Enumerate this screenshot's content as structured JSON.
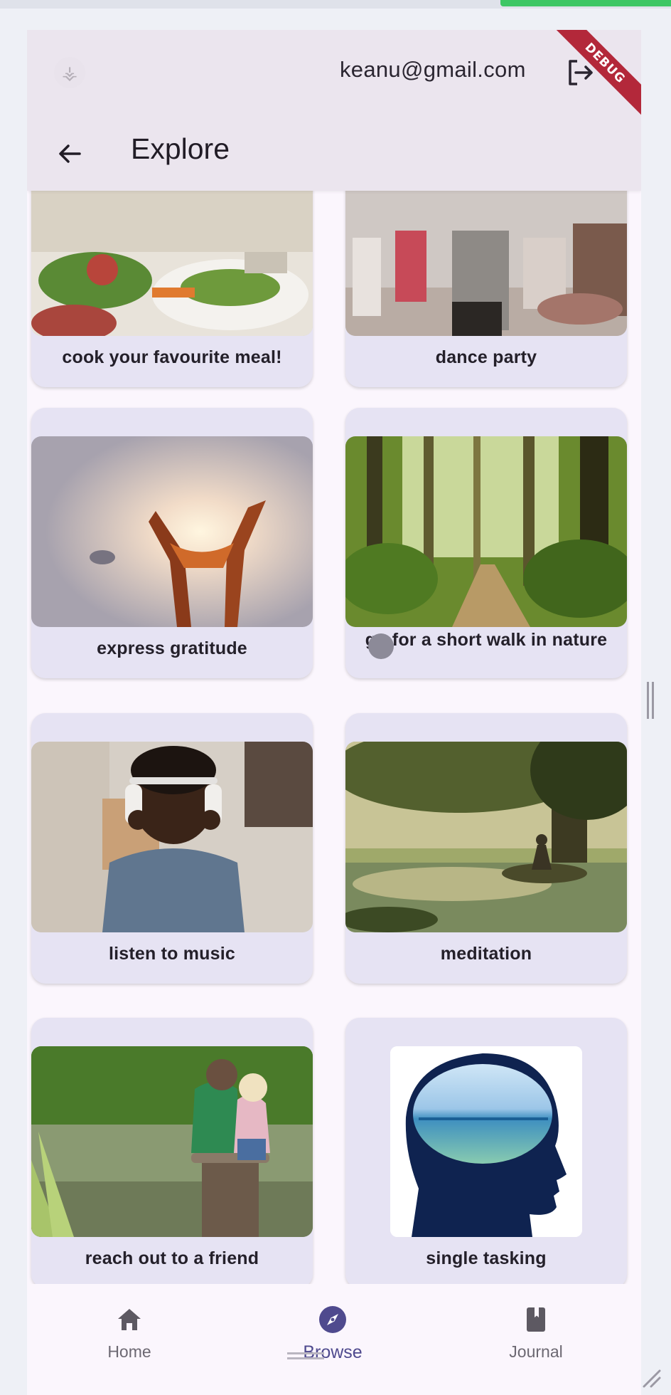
{
  "header": {
    "user_email": "keanu@gmail.com",
    "debug_label": "DEBUG",
    "title": "Explore"
  },
  "cards": [
    {
      "label": "cook your favourite meal!"
    },
    {
      "label": "dance party"
    },
    {
      "label": "express gratitude"
    },
    {
      "label": "go for a short walk in nature"
    },
    {
      "label": "listen to music"
    },
    {
      "label": "meditation"
    },
    {
      "label": "reach out to a friend"
    },
    {
      "label": "single tasking"
    }
  ],
  "nav": {
    "home": "Home",
    "browse": "Browse",
    "journal": "Journal"
  },
  "colors": {
    "accent": "#4f4a8e",
    "card_bg": "#e6e3f3",
    "appbar_bg": "#ebe5ee",
    "debug": "#b3283a",
    "progress": "#3ec765"
  }
}
